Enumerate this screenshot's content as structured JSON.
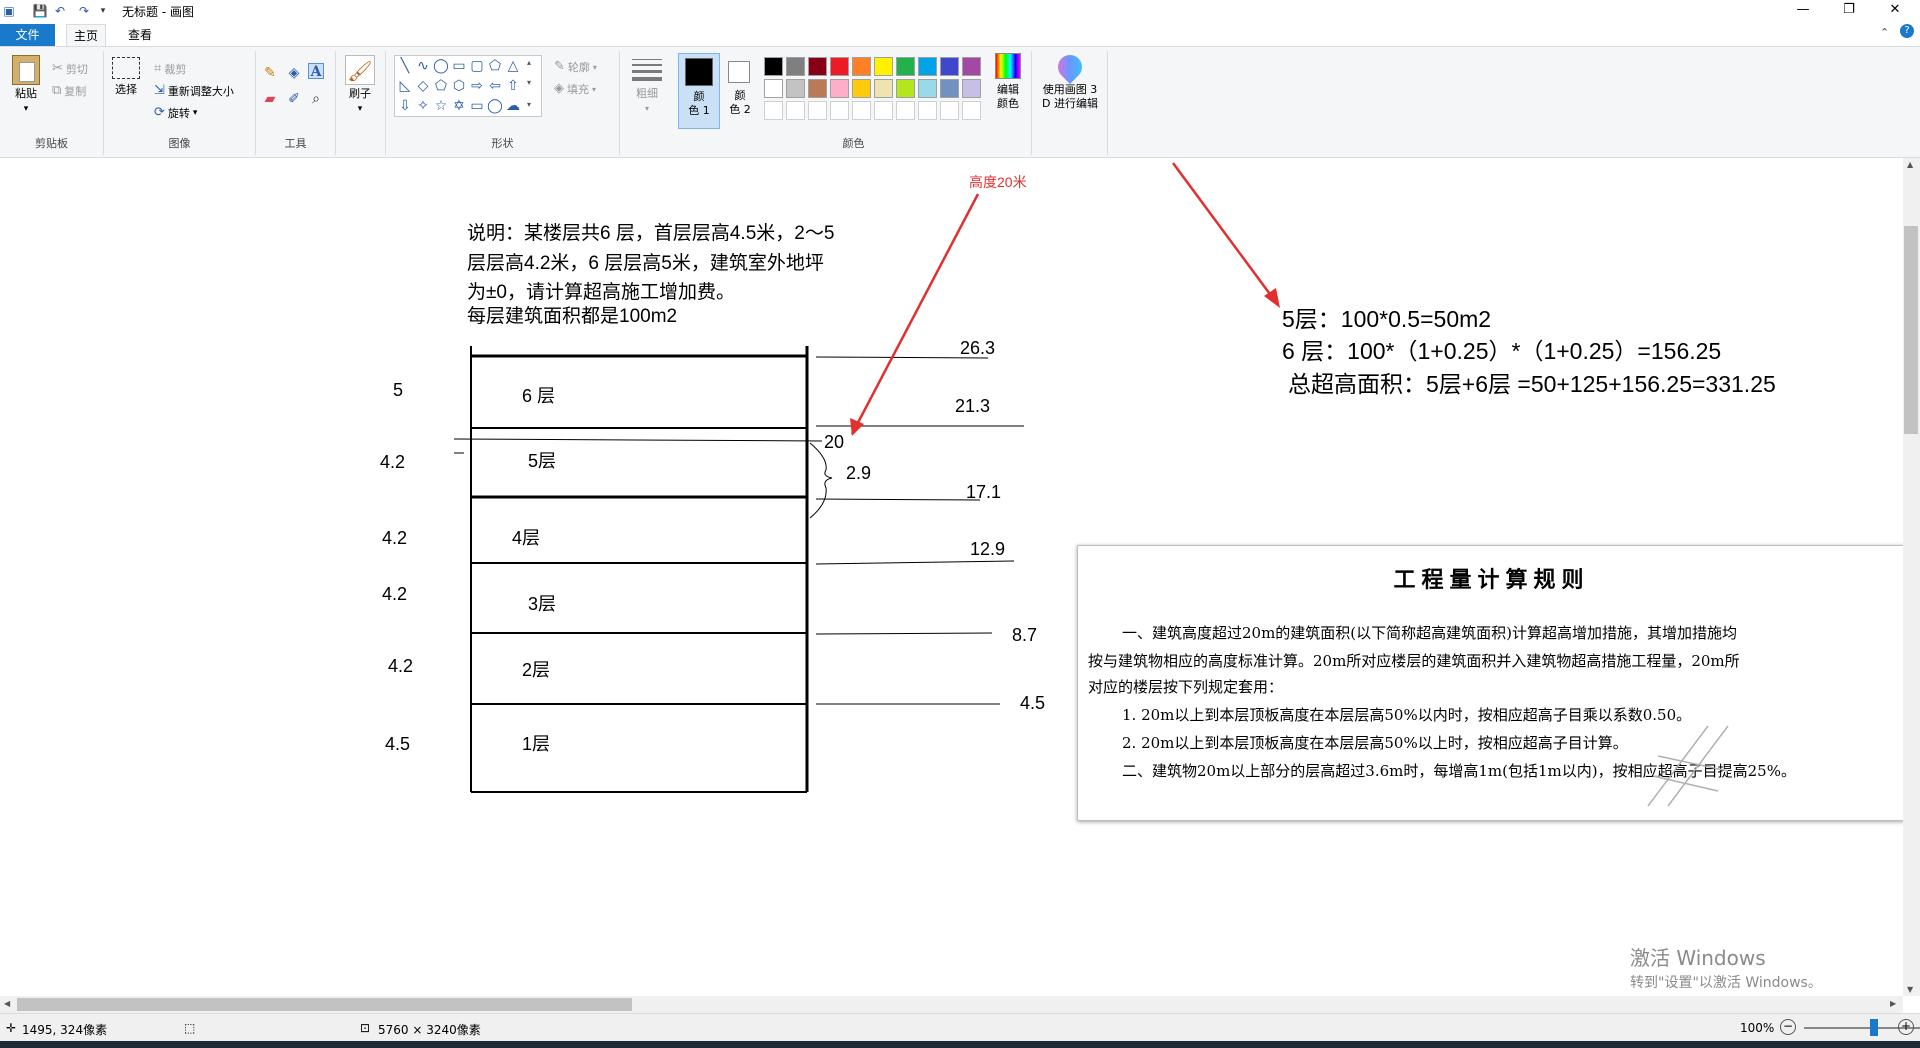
{
  "window": {
    "title": "无标题 - 画图",
    "min": "—",
    "max": "❐",
    "close": "✕"
  },
  "quick_access": {
    "save_icon": "save-icon",
    "undo_icon": "undo-icon",
    "redo_icon": "redo-icon"
  },
  "tabs": {
    "file": "文件",
    "home": "主页",
    "view": "查看"
  },
  "ribbon": {
    "clipboard": {
      "label": "剪贴板",
      "paste": "粘贴",
      "cut": "剪切",
      "copy": "复制"
    },
    "image": {
      "label": "图像",
      "select": "选择",
      "crop": "裁剪",
      "resize": "重新调整大小",
      "rotate": "旋转"
    },
    "tools": {
      "label": "工具"
    },
    "brush": {
      "label": "刷子"
    },
    "shapes": {
      "label": "形状",
      "outline": "轮廓",
      "fill": "填充"
    },
    "size": {
      "label": "粗细"
    },
    "color1": {
      "label1": "颜",
      "label2": "色 1"
    },
    "color2": {
      "label1": "颜",
      "label2": "色 2"
    },
    "colors": {
      "label": "颜色",
      "edit1": "编辑",
      "edit2": "颜色",
      "row1": [
        "#000000",
        "#7f7f7f",
        "#880015",
        "#ed1c24",
        "#ff7f27",
        "#fff200",
        "#22b14c",
        "#00a2e8",
        "#3f48cc",
        "#a349a4"
      ],
      "row2": [
        "#ffffff",
        "#c3c3c3",
        "#b97a57",
        "#ffaec9",
        "#ffc90e",
        "#efe4b0",
        "#b5e61d",
        "#99d9ea",
        "#7092be",
        "#c8bfe7"
      ]
    },
    "paint3d": {
      "label1": "使用画图 3",
      "label2": "D 进行编辑"
    }
  },
  "canvas": {
    "desc": [
      "说明：某楼层共6 层，首层层高4.5米，2～5",
      "层层高4.2米，6 层层高5米，建筑室外地坪",
      "为±0，请计算超高施工增加费。",
      " 每层建筑面积都是100m2"
    ],
    "annotation_red": "高度20米",
    "floors": [
      "6 层",
      "5层",
      "4层",
      "3层",
      "2层",
      "1层"
    ],
    "heights": [
      "5",
      "4.2",
      "4.2",
      "4.2",
      "4.2",
      "4.5"
    ],
    "elev": [
      "26.3",
      "21.3",
      "20",
      "2.9",
      "17.1",
      "12.9",
      "8.7",
      "4.5"
    ],
    "calc": [
      "5层：100*0.5=50m2",
      "6 层：100*（1+0.25）*（1+0.25）=156.25",
      "总超高面积：5层+6层 =50+125+156.25=331.25"
    ]
  },
  "rules": {
    "title": "工程量计算规则",
    "l1": "一、建筑高度超过20m的建筑面积(以下简称超高建筑面积)计算超高增加措施，其增加措施均",
    "l2": "按与建筑物相应的高度标准计算。20m所对应楼层的建筑面积并入建筑物超高措施工程量，20m所",
    "l3": "对应的楼层按下列规定套用：",
    "l4": "1. 20m以上到本层顶板高度在本层层高50%以内时，按相应超高子目乘以系数0.50。",
    "l5": "2. 20m以上到本层顶板高度在本层层高50%以上时，按相应超高子目计算。",
    "l6": "二、建筑物20m以上部分的层高超过3.6m时，每增高1m(包括1m以内)，按相应超高子目提高25%。"
  },
  "watermark": {
    "line1": "激活 Windows",
    "line2": "转到\"设置\"以激活 Windows。"
  },
  "status": {
    "cursor_pos": "1495, 324像素",
    "image_size": "5760 × 3240像素",
    "zoom": "100%"
  },
  "zoom": {
    "level": 0.5
  }
}
